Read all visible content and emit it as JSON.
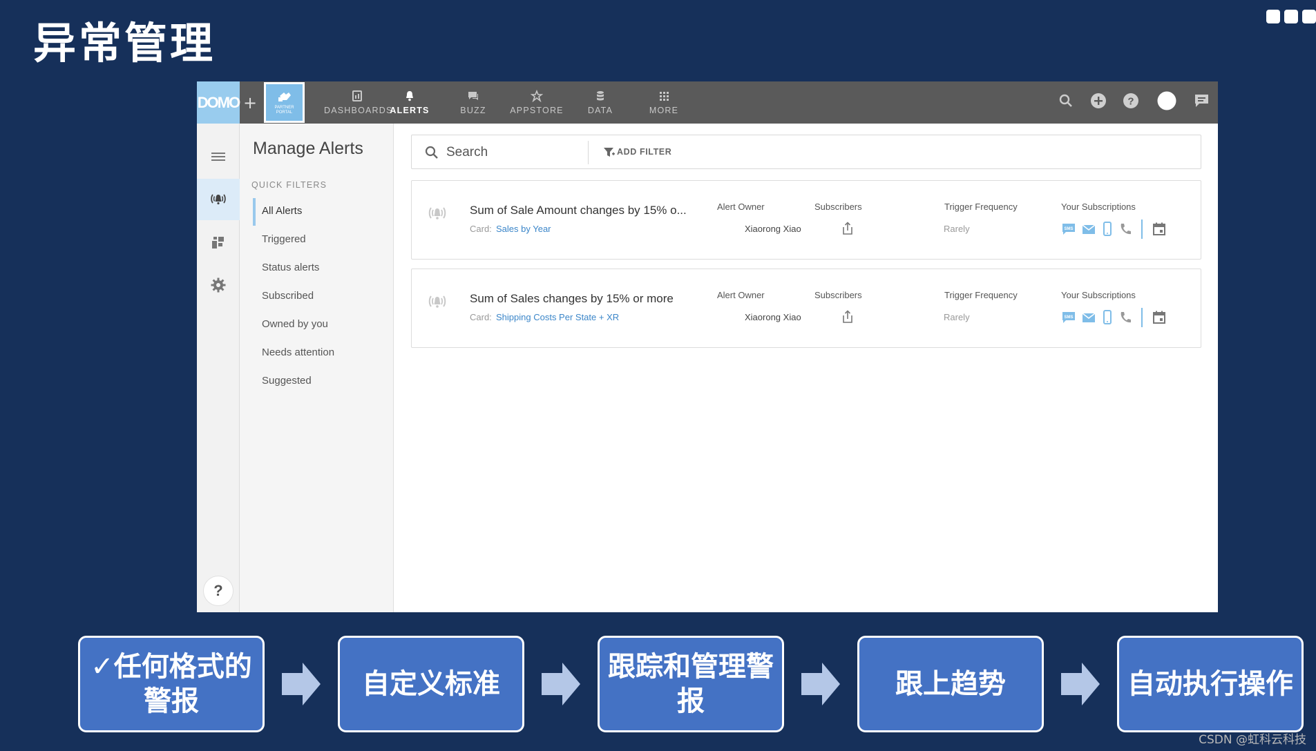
{
  "slide": {
    "title": "异常管理",
    "watermark": "CSDN @虹科云科技"
  },
  "topnav": {
    "logo": "DOMO",
    "plus": "+",
    "partner_label": "PARTNER PORTAL",
    "items": [
      {
        "label": "DASHBOARDS",
        "icon": "dashboards-icon"
      },
      {
        "label": "ALERTS",
        "icon": "bell-icon",
        "active": true
      },
      {
        "label": "BUZZ",
        "icon": "chat-icon"
      },
      {
        "label": "APPSTORE",
        "icon": "appstore-icon"
      },
      {
        "label": "DATA",
        "icon": "database-icon"
      },
      {
        "label": "MORE",
        "icon": "grid-icon"
      }
    ]
  },
  "rail": {
    "help": "?"
  },
  "filters": {
    "title": "Manage Alerts",
    "section": "QUICK FILTERS",
    "items": [
      "All Alerts",
      "Triggered",
      "Status alerts",
      "Subscribed",
      "Owned by you",
      "Needs attention",
      "Suggested"
    ],
    "active": "All Alerts"
  },
  "search": {
    "placeholder": "Search",
    "add_filter": "ADD FILTER"
  },
  "columns": {
    "owner": "Alert Owner",
    "subscribers": "Subscribers",
    "frequency": "Trigger Frequency",
    "subscriptions": "Your Subscriptions"
  },
  "alerts": [
    {
      "title": "Sum of Sale Amount changes by 15% o...",
      "card_label": "Card:",
      "card_name": "Sales by Year",
      "owner": "Xiaorong Xiao",
      "frequency": "Rarely"
    },
    {
      "title": "Sum of Sales changes by 15% or more",
      "card_label": "Card:",
      "card_name": "Shipping Costs Per State + XR",
      "owner": "Xiaorong Xiao",
      "frequency": "Rarely"
    }
  ],
  "colors": {
    "slide_bg": "#16305a",
    "nav_bg": "#5a5a5a",
    "accent": "#7fbde8",
    "step_bg": "#4472c4",
    "link": "#3b86c9"
  },
  "flow": {
    "steps": [
      "✓任何格式的警报",
      "自定义标准",
      "跟踪和管理警报",
      "跟上趋势",
      "自动执行操作"
    ]
  }
}
